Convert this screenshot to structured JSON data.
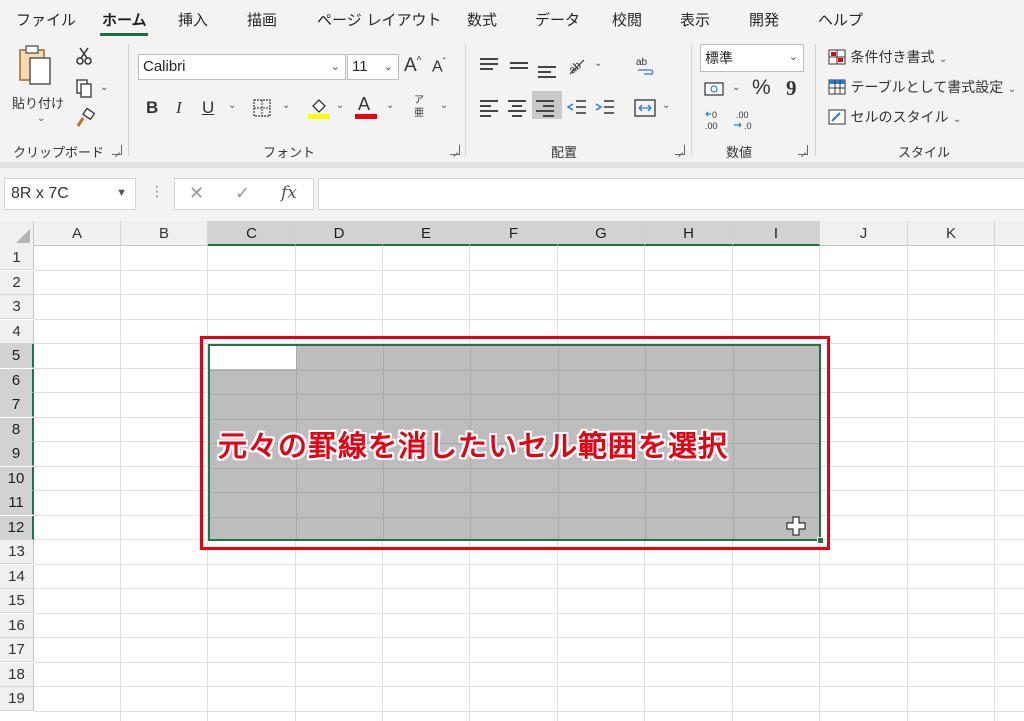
{
  "tabs": [
    "ファイル",
    "ホーム",
    "挿入",
    "描画",
    "ページ レイアウト",
    "数式",
    "データ",
    "校閲",
    "表示",
    "開発",
    "ヘルプ"
  ],
  "ribbon": {
    "clipboard": {
      "paste_label": "貼り付け",
      "group_label": "クリップボード"
    },
    "font": {
      "font_name": "Calibri",
      "font_size": "11",
      "group_label": "フォント",
      "bold": "B",
      "italic": "I",
      "underline": "U",
      "grow": "A",
      "shrink": "A",
      "color_letter": "A",
      "phonetic_top": "ア",
      "phonetic_bottom": "亜"
    },
    "alignment": {
      "group_label": "配置"
    },
    "number": {
      "format": "標準",
      "group_label": "数値",
      "percent": "%",
      "comma": "9"
    },
    "styles": {
      "conditional": "条件付き書式",
      "as_table": "テーブルとして書式設定",
      "cell_styles": "セルのスタイル",
      "group_label": "スタイル"
    }
  },
  "formula_bar": {
    "name_box": "8R x 7C",
    "cancel": "✕",
    "enter": "✓",
    "fx": "fx",
    "formula": ""
  },
  "grid": {
    "columns": [
      "A",
      "B",
      "C",
      "D",
      "E",
      "F",
      "G",
      "H",
      "I",
      "J",
      "K"
    ],
    "rows": [
      "1",
      "2",
      "3",
      "4",
      "5",
      "6",
      "7",
      "8",
      "9",
      "10",
      "11",
      "12",
      "13",
      "14",
      "15",
      "16",
      "17",
      "18",
      "19"
    ],
    "selected_columns": [
      "C",
      "D",
      "E",
      "F",
      "G",
      "H",
      "I"
    ],
    "selected_rows": [
      "5",
      "6",
      "7",
      "8",
      "9",
      "10",
      "11",
      "12"
    ]
  },
  "annotation": "元々の罫線を消したいセル範囲を選択",
  "colors": {
    "accent": "#217346",
    "annotation": "#e60012",
    "selection_fill": "#bdbdbd"
  }
}
